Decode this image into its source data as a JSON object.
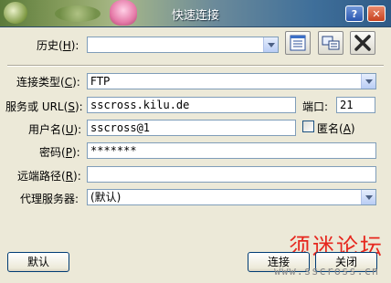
{
  "window": {
    "title": "快速连接",
    "help_label": "?",
    "close_label": "✕"
  },
  "history": {
    "label": "历史",
    "accel": "H",
    "value": ""
  },
  "toolbar": {
    "icon1": "address-book-icon",
    "icon2": "connection-settings-icon",
    "icon3": "delete-x-icon"
  },
  "connection": {
    "label": "连接类型",
    "accel": "C",
    "value": "FTP"
  },
  "server": {
    "label": "服务或 URL",
    "accel": "S",
    "value": "sscross.kilu.de"
  },
  "port": {
    "label": "端口",
    "value": "21"
  },
  "username": {
    "label": "用户名",
    "accel": "U",
    "value": "sscross@1"
  },
  "anonymous": {
    "label": "匿名",
    "accel": "A",
    "checked": false
  },
  "password": {
    "label": "密码",
    "accel": "P",
    "value": "*******"
  },
  "remote_path": {
    "label": "远端路径",
    "accel": "R",
    "value": ""
  },
  "proxy": {
    "label": "代理服务器",
    "value": "(默认)"
  },
  "buttons": {
    "default": "默认",
    "connect": "连接",
    "close": "关闭"
  },
  "watermark": {
    "title": "须迷论坛",
    "url": "www.sscross.cn"
  }
}
